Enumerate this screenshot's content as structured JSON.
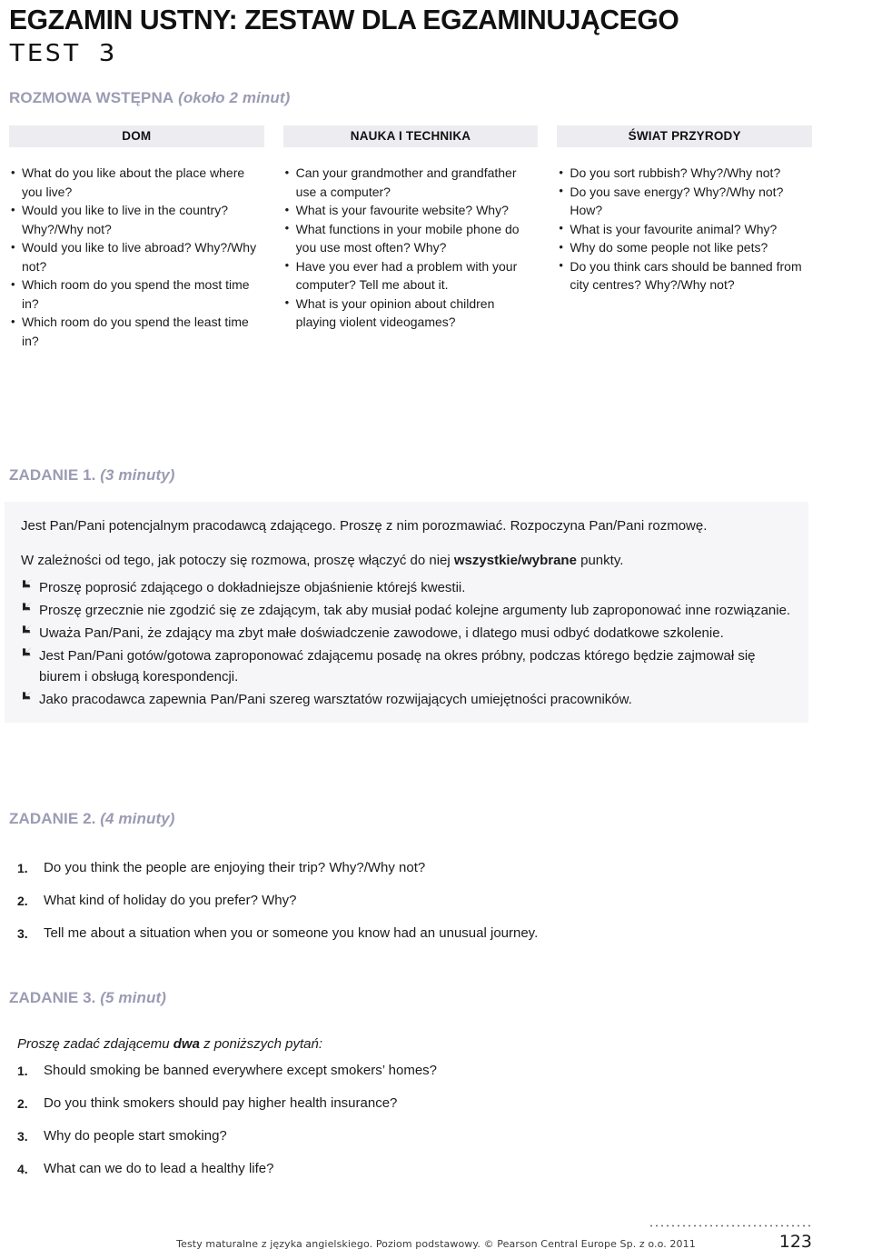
{
  "document": {
    "main_title": "EGZAMIN USTNY: ZESTAW DLA EGZAMINUJĄCEGO",
    "test_label": "TEST 3",
    "accent_color": "#9b9bb4",
    "panel_color": "#f6f5f8",
    "topic_box_color": "#edecf1"
  },
  "intro_section": {
    "heading_label": "ROZMOWA WSTĘPNA",
    "heading_duration": " (około 2 minut)",
    "topics": [
      {
        "title": "DOM"
      },
      {
        "title": "NAUKA I TECHNIKA"
      },
      {
        "title": "ŚWIAT PRZYRODY"
      }
    ],
    "columns": [
      {
        "questions": [
          "What do you like about the place where you live?",
          "Would you like to live in the country? Why?/Why not?",
          "Would you like to live abroad? Why?/Why not?",
          "Which room do you spend the most time in?",
          "Which room do you spend the least time in?"
        ]
      },
      {
        "questions": [
          "Can your grandmother and grandfather use a computer?",
          "What is your favourite website? Why?",
          "What functions in your mobile phone do you use most often? Why?",
          "Have you ever had a problem with your computer? Tell me about it.",
          "What is your opinion about children playing violent videogames?"
        ]
      },
      {
        "questions": [
          "Do you sort rubbish? Why?/Why not?",
          "Do you save energy? Why?/Why not? How?",
          "What is your favourite animal? Why?",
          "Why do some people not like pets?",
          "Do you think cars should be banned from city centres? Why?/Why not?"
        ]
      }
    ]
  },
  "task1": {
    "heading_label": "ZADANIE 1.",
    "heading_duration": " (3 minuty)",
    "intro": "Jest Pan/Pani potencjalnym pracodawcą zdającego. Proszę z nim porozmawiać. Rozpoczyna Pan/Pani rozmowę.",
    "instruction_before": "W zależności od tego, jak potoczy się rozmowa, proszę włączyć do niej ",
    "instruction_bold": "wszystkie/wybrane",
    "instruction_after": " punkty.",
    "points": [
      "Proszę poprosić zdającego o dokładniejsze objaśnienie którejś kwestii.",
      "Proszę grzecznie nie zgodzić się ze zdającym, tak aby musiał podać kolejne argumenty lub zaproponować inne rozwiązanie.",
      "Uważa Pan/Pani, że zdający ma zbyt małe doświadczenie zawodowe, i dlatego musi odbyć dodatkowe szkolenie.",
      "Jest Pan/Pani gotów/gotowa zaproponować zdającemu posadę na okres próbny, podczas którego będzie zajmował się biurem i obsługą korespondencji.",
      "Jako pracodawca zapewnia Pan/Pani szereg warsztatów rozwijających umiejętności pracowników."
    ]
  },
  "task2": {
    "heading_label": "ZADANIE 2.",
    "heading_duration": " (4 minuty)",
    "questions": [
      {
        "num": "1.",
        "text": "Do you think the people are enjoying their trip? Why?/Why not?"
      },
      {
        "num": "2.",
        "text": "What kind of holiday do you prefer? Why?"
      },
      {
        "num": "3.",
        "text": "Tell me about a situation when you or someone you know had an unusual journey."
      }
    ]
  },
  "task3": {
    "heading_label": "ZADANIE 3.",
    "heading_duration": " (5 minut)",
    "intro_before": "Proszę zadać zdającemu ",
    "intro_bold": "dwa",
    "intro_after": " z poniższych pytań:",
    "questions": [
      {
        "num": "1.",
        "text": "Should smoking be banned everywhere except smokers’ homes?"
      },
      {
        "num": "2.",
        "text": "Do you think smokers should pay higher health insurance?"
      },
      {
        "num": "3.",
        "text": "Why do people start smoking?"
      },
      {
        "num": "4.",
        "text": "What can we do to lead a healthy life?"
      }
    ]
  },
  "footer": {
    "credit": "Testy maturalne z języka angielskiego. Poziom podstawowy. © Pearson Central Europe Sp. z o.o. 2011",
    "page_number": "123"
  }
}
